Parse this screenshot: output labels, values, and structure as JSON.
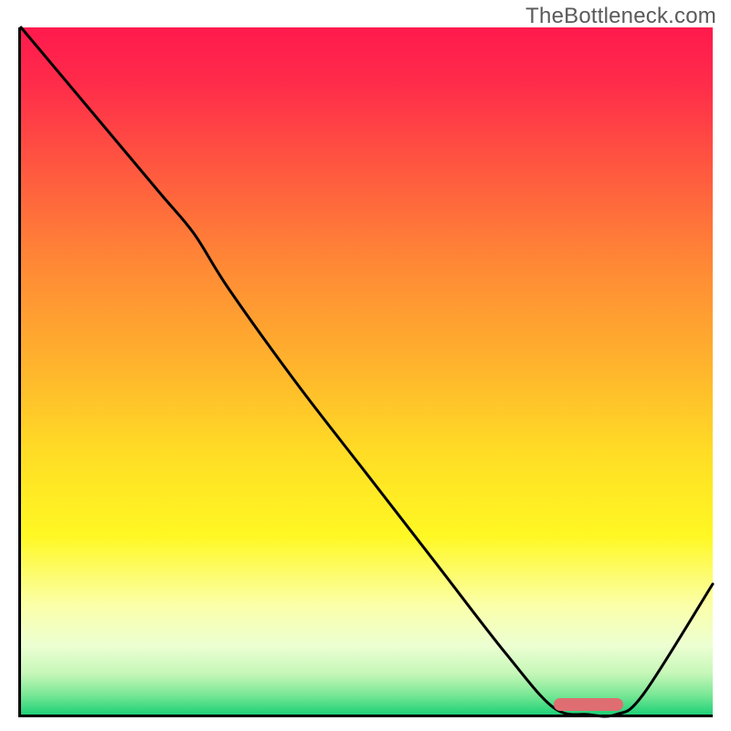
{
  "watermark": "TheBottleneck.com",
  "colors": {
    "curve": "#000000",
    "optimum_marker": "#de6e71",
    "axis": "#000000"
  },
  "chart_data": {
    "type": "line",
    "title": "",
    "xlabel": "",
    "ylabel": "",
    "xlim": [
      0,
      100
    ],
    "ylim": [
      0,
      100
    ],
    "grid": false,
    "series": [
      {
        "name": "bottleneck-curve",
        "x": [
          0,
          10,
          20,
          25,
          30,
          40,
          50,
          60,
          70,
          77,
          82,
          86,
          90,
          100
        ],
        "y": [
          100,
          88,
          76,
          70,
          62,
          48,
          35,
          22,
          9,
          1,
          0,
          0,
          3,
          19
        ]
      }
    ],
    "annotations": [
      {
        "name": "optimum-zone",
        "shape": "pill",
        "x_range": [
          77,
          87
        ],
        "y": 1.5,
        "color": "#de6e71"
      }
    ]
  }
}
